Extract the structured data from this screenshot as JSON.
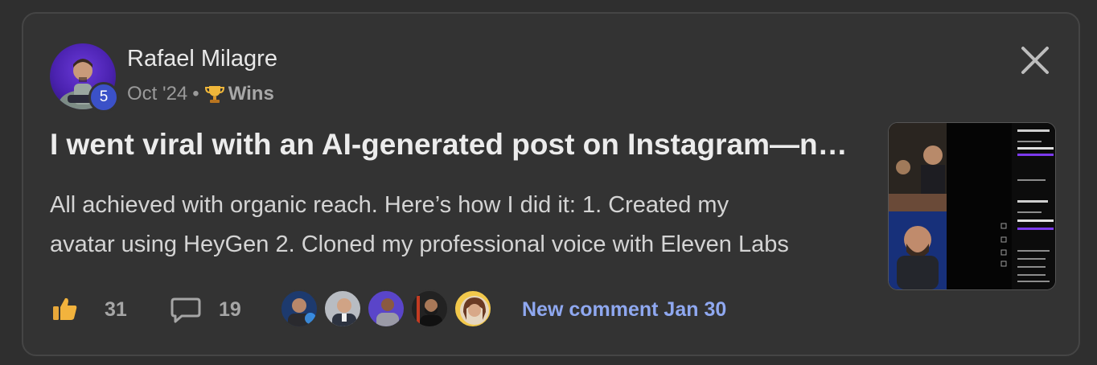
{
  "post": {
    "author": "Rafael Milagre",
    "level": "5",
    "date": "Oct '24",
    "separator": "•",
    "category": "Wins",
    "title": "I went viral with an AI-generated post on Instagram—n…",
    "excerpt_line1": "All achieved with organic reach. Here’s how I did it: 1. Created my",
    "excerpt_line2": "avatar using HeyGen 2. Cloned my professional voice with Eleven Labs"
  },
  "stats": {
    "likes": "31",
    "comments": "19",
    "new_comment": "New comment Jan 30"
  },
  "icons": {
    "close": "close-icon",
    "like": "thumbs-up-icon",
    "comment": "comment-bubble-icon",
    "trophy": "trophy-icon"
  },
  "colors": {
    "background": "#333333",
    "accent_link": "#8fa8f0",
    "level_badge": "#3b51c8",
    "like": "#f2b33d"
  }
}
